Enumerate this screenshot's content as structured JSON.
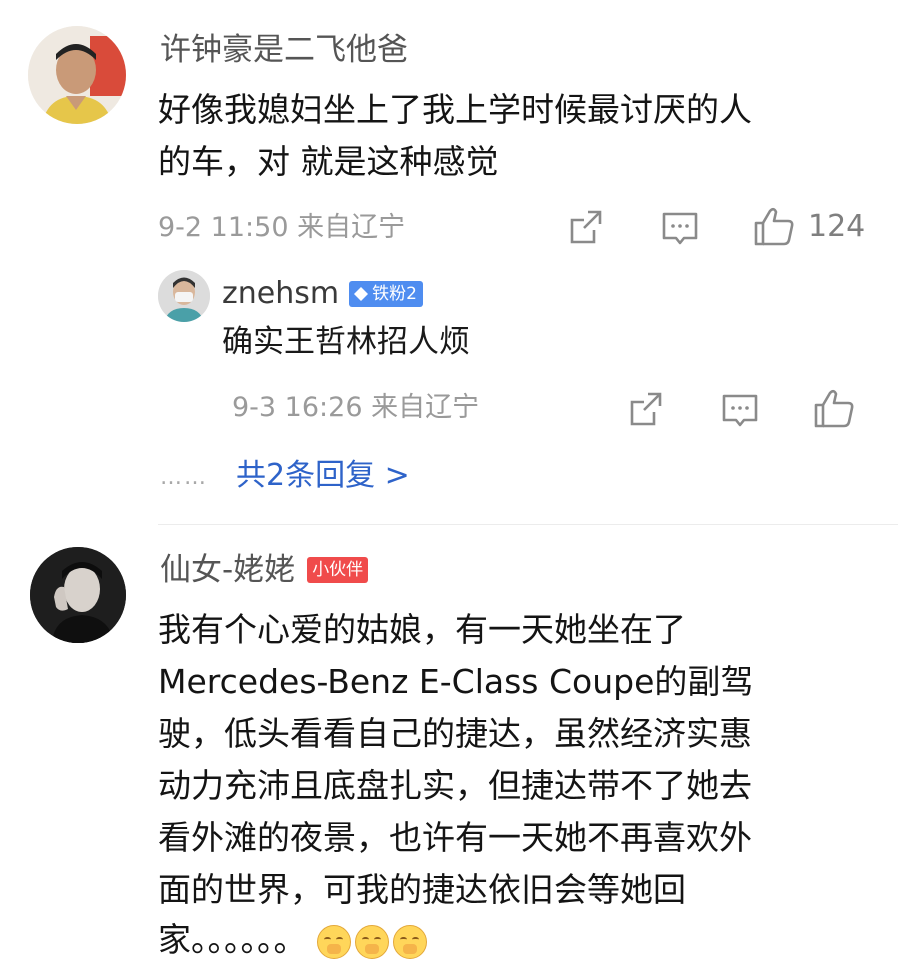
{
  "comment1": {
    "username": "许钟豪是二飞他爸",
    "text_lines": [
      "好像我媳妇坐上了我上学时候最讨厌的人",
      "的车，对 就是这种感觉"
    ],
    "meta": "9-2 11:50 来自辽宁",
    "like_count": "124"
  },
  "reply1": {
    "username": "znehsm",
    "badge": "铁粉2",
    "text": "确实王哲林招人烦",
    "meta": "9-3 16:26 来自辽宁"
  },
  "more_replies": {
    "dots": "……",
    "label": "共2条回复 >"
  },
  "comment2": {
    "username": "仙女-姥姥",
    "badge": "小伙伴",
    "text_lines": [
      "我有个心爱的姑娘，有一天她坐在了",
      "Mercedes-Benz E-Class Coupe的副驾",
      "驶，低头看看自己的捷达，虽然经济实惠",
      "动力充沛且底盘扎实，但捷达带不了她去",
      "看外滩的夜景，也许有一天她不再喜欢外",
      "面的世界，可我的捷达依旧会等她回"
    ],
    "last_line_text": "家。。。。。。",
    "emoji_names": [
      "shush-emoji",
      "shush-emoji",
      "shush-emoji"
    ]
  },
  "colors": {
    "link": "#2e63c9",
    "fan_badge": "#4f8df0",
    "partner_badge": "#f04b4b",
    "meta_gray": "#9a9a9a"
  }
}
